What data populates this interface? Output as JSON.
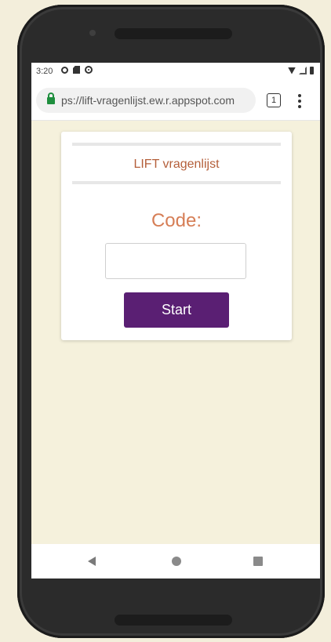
{
  "status_bar": {
    "time": "3:20",
    "icons": [
      "gear-icon",
      "sd-card-icon",
      "sync-icon"
    ],
    "right_icons": [
      "wifi-icon",
      "signal-icon",
      "battery-icon"
    ]
  },
  "browser": {
    "url": "ps://lift-vragenlijst.ew.r.appspot.com",
    "tab_count": "1"
  },
  "card": {
    "title": "LIFT vragenlijst",
    "code_label": "Code:",
    "code_input_value": "",
    "start_label": "Start"
  },
  "colors": {
    "page_background": "#f5f1dc",
    "title_color": "#b45f3a",
    "code_label_color": "#d67e56",
    "start_button": "#5a1f73",
    "lock_color": "#1e8e3e"
  },
  "nav_bar": {
    "icons": [
      "back-icon",
      "home-icon",
      "recents-icon"
    ]
  }
}
